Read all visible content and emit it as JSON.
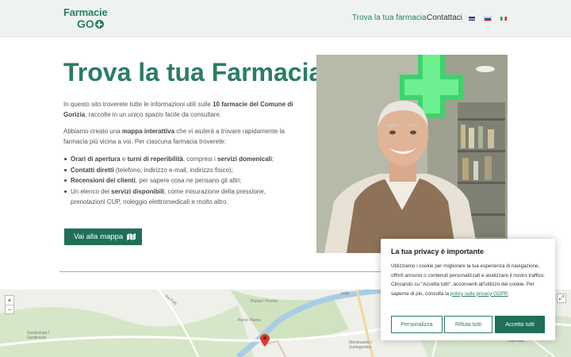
{
  "header": {
    "logo_line1": "Farmacie",
    "logo_line2": "GO",
    "nav": [
      {
        "label": "Trova la tua farmacia"
      },
      {
        "label": "Contattaci"
      }
    ],
    "languages": [
      "en",
      "sl",
      "it"
    ]
  },
  "hero": {
    "title": "Trova la tua Farmacia",
    "p1": {
      "a": "In questo sito troverete tutte le informazioni utili sulle ",
      "b": "10 farmacie del Comune di Gorizia",
      "c": ", raccolte in un unico spazio facile da consultare."
    },
    "p2": {
      "a": "Abbiamo creato una ",
      "b": "mappa interattiva",
      "c": " che vi aiuterà a trovare rapidamente la farmacia più vicina a voi. Per ciascuna farmacia troverete:"
    },
    "features": [
      {
        "parts": [
          [
            "b",
            "Orari di apertura"
          ],
          [
            "t",
            " e "
          ],
          [
            "b",
            "turni di reperibilità"
          ],
          [
            "t",
            ", compresi i "
          ],
          [
            "b",
            "servizi domenicali"
          ],
          [
            "t",
            ";"
          ]
        ]
      },
      {
        "parts": [
          [
            "b",
            "Contatti diretti"
          ],
          [
            "t",
            " (telefono, indirizzo e-mail, indirizzo fisico);"
          ]
        ]
      },
      {
        "parts": [
          [
            "b",
            "Recensioni dei clienti"
          ],
          [
            "t",
            ", per sapere cosa ne pensano gli altri;"
          ]
        ]
      },
      {
        "parts": [
          [
            "t",
            "Un elenco dei "
          ],
          [
            "b",
            "servizi disponibili"
          ],
          [
            "t",
            ", come misurazione della pressione, prenotazioni CUP, noleggio elettromedicali e molto altro."
          ]
        ]
      }
    ],
    "map_button": "Vai alla mappa"
  },
  "map": {
    "zoom_in": "+",
    "zoom_out": "−",
    "fullscreen": "⤢",
    "labels": [
      "Piuma / Pevma",
      "Parco Piuma",
      "Gardisciuta / Gardiscuta",
      "Montesanto / Svetogorska",
      "Ospedale",
      "polje",
      "Via Faiti"
    ]
  },
  "cookie": {
    "title": "La tua privacy è importante",
    "text": "Utilizziamo i cookie per migliorare la tua esperienza di navigazione, offrirti annunci o contenuti personalizzati e analizzare il nostro traffico. Cliccando su \"Accetta tutti\", acconsenti all'utilizzo dei cookie. Per saperne di più, consulta la ",
    "link": "policy sulla privacy GDPR",
    "link_after": ".",
    "buttons": {
      "customize": "Personalizza",
      "reject": "Rifiuta tutti",
      "accept": "Accetta tutti"
    }
  },
  "colors": {
    "brand": "#2b7d67",
    "button": "#1f6f59",
    "header_bg": "#eef3f1"
  }
}
